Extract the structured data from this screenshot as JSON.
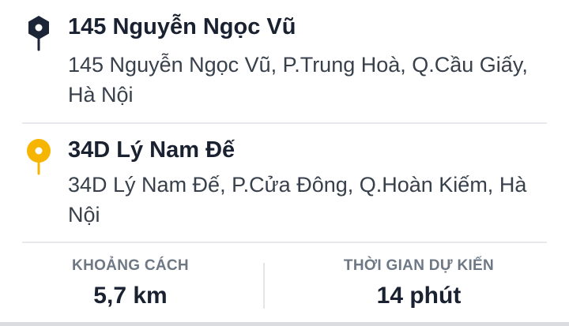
{
  "origin": {
    "title": "145 Nguyễn Ngọc Vũ",
    "address": "145 Nguyễn Ngọc Vũ, P.Trung Hoà, Q.Cầu Giấy, Hà Nội",
    "pin_icon": "origin-pin-icon",
    "pin_color": "#1b2536"
  },
  "destination": {
    "title": "34D Lý Nam Đế",
    "address": "34D Lý Nam Đế, P.Cửa Đông, Q.Hoàn Kiếm, Hà Nội",
    "pin_icon": "destination-pin-icon",
    "pin_color": "#f6b500"
  },
  "stats": {
    "distance_label": "KHOẢNG CÁCH",
    "distance_value": "5,7 km",
    "time_label": "THỜI GIAN DỰ KIẾN",
    "time_value": "14 phút"
  }
}
